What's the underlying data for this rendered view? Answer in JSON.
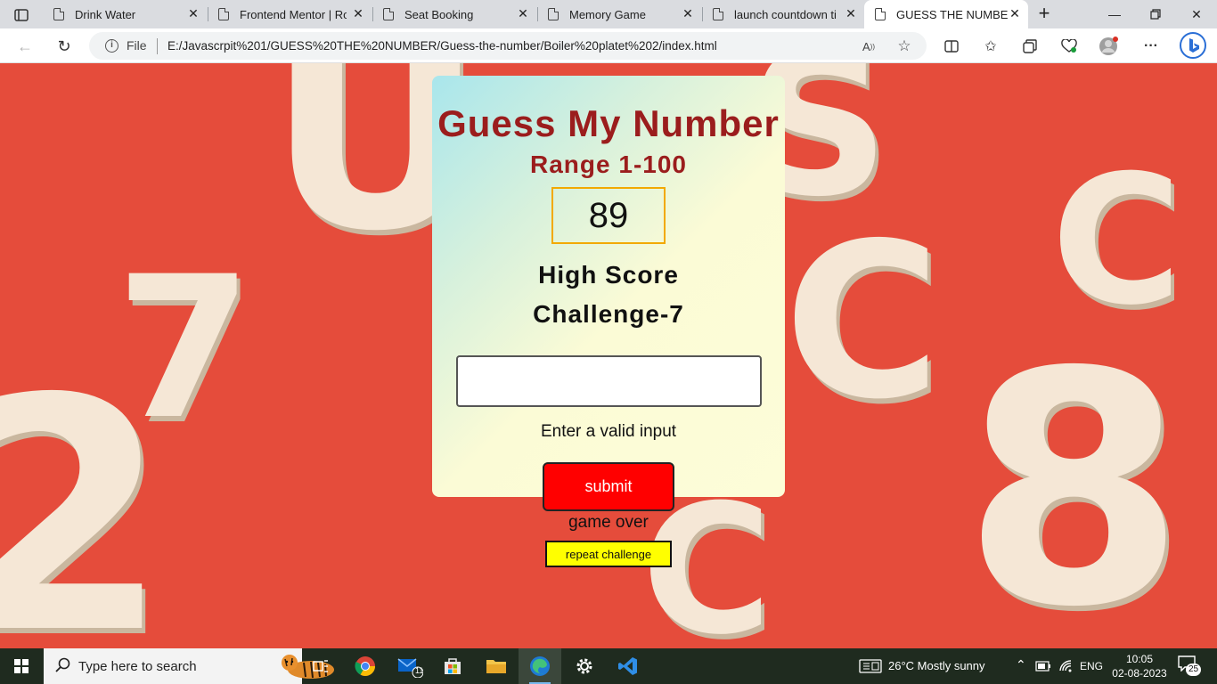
{
  "browser": {
    "tabs": [
      {
        "title": "Drink Water",
        "active": false
      },
      {
        "title": "Frontend Mentor | Roc",
        "active": false
      },
      {
        "title": "Seat Booking",
        "active": false
      },
      {
        "title": "Memory Game",
        "active": false
      },
      {
        "title": "launch countdown tim",
        "active": false
      },
      {
        "title": "GUESS THE NUMBER",
        "active": true
      }
    ],
    "address": {
      "scheme_label": "File",
      "url": "E:/Javascrpit%201/GUESS%20THE%20NUMBER/Guess-the-number/Boiler%20platet%202/index.html"
    }
  },
  "game": {
    "title": "Guess My Number",
    "range": "Range 1-100",
    "number": "89",
    "high_score_label": "High Score",
    "challenge": "Challenge-7",
    "input_value": "",
    "hint": "Enter a valid input",
    "submit_label": "submit",
    "status": "game over",
    "repeat_label": "repeat challenge"
  },
  "taskbar": {
    "search_placeholder": "Type here to search",
    "mail_badge": "11",
    "weather": "26°C  Mostly sunny",
    "language": "ENG",
    "time": "10:05",
    "date": "02-08-2023",
    "notification_count": "25"
  },
  "colors": {
    "accent_red": "#9b1d1d",
    "submit_bg": "#ff0000",
    "repeat_bg": "#ffff00",
    "number_border": "#f2a900"
  }
}
